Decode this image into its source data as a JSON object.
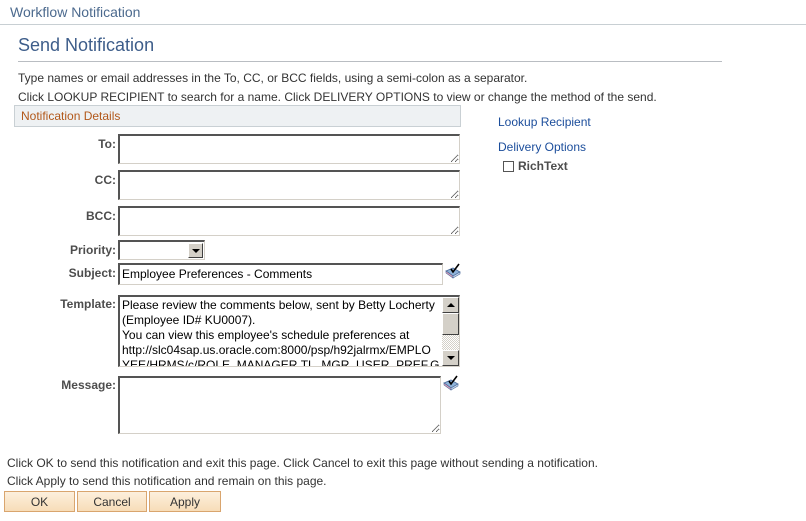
{
  "header": {
    "title": "Workflow Notification"
  },
  "page": {
    "title": "Send Notification",
    "instructions": [
      "Type names or email addresses in the To, CC, or BCC fields, using a semi-colon as a separator.",
      "Click LOOKUP RECIPIENT to search for a name.  Click DELIVERY OPTIONS to view or change the method of the send."
    ]
  },
  "section": {
    "title": "Notification Details"
  },
  "form": {
    "to": {
      "label": "To:",
      "value": ""
    },
    "cc": {
      "label": "CC:",
      "value": ""
    },
    "bcc": {
      "label": "BCC:",
      "value": ""
    },
    "priority": {
      "label": "Priority:",
      "selected": ""
    },
    "subject": {
      "label": "Subject:",
      "value": "Employee Preferences - Comments",
      "icon": "spell-check-icon"
    },
    "template": {
      "label": "Template:",
      "lines": [
        "Please review the comments below, sent by Betty Locherty",
        "(Employee ID# KU0007).",
        "You can view this employee's schedule preferences at",
        "http://slc04sap.us.oracle.com:8000/psp/h92jalrmx/EMPLO",
        "YEE/HRMS/c/ROLE_MANAGER.TL_MGR_USER_PREF.G"
      ]
    },
    "message": {
      "label": "Message:",
      "value": "",
      "icon": "spell-check-icon"
    }
  },
  "side": {
    "lookup_recipient": "Lookup Recipient",
    "delivery_options": "Delivery Options",
    "richtext": {
      "label": "RichText",
      "checked": false
    }
  },
  "footer": {
    "instructions": [
      "Click OK to send this notification and exit this page.  Click Cancel to exit this page without sending a notification.",
      "Click Apply to send this notification and remain on this page."
    ],
    "buttons": {
      "ok": "OK",
      "cancel": "Cancel",
      "apply": "Apply"
    }
  }
}
